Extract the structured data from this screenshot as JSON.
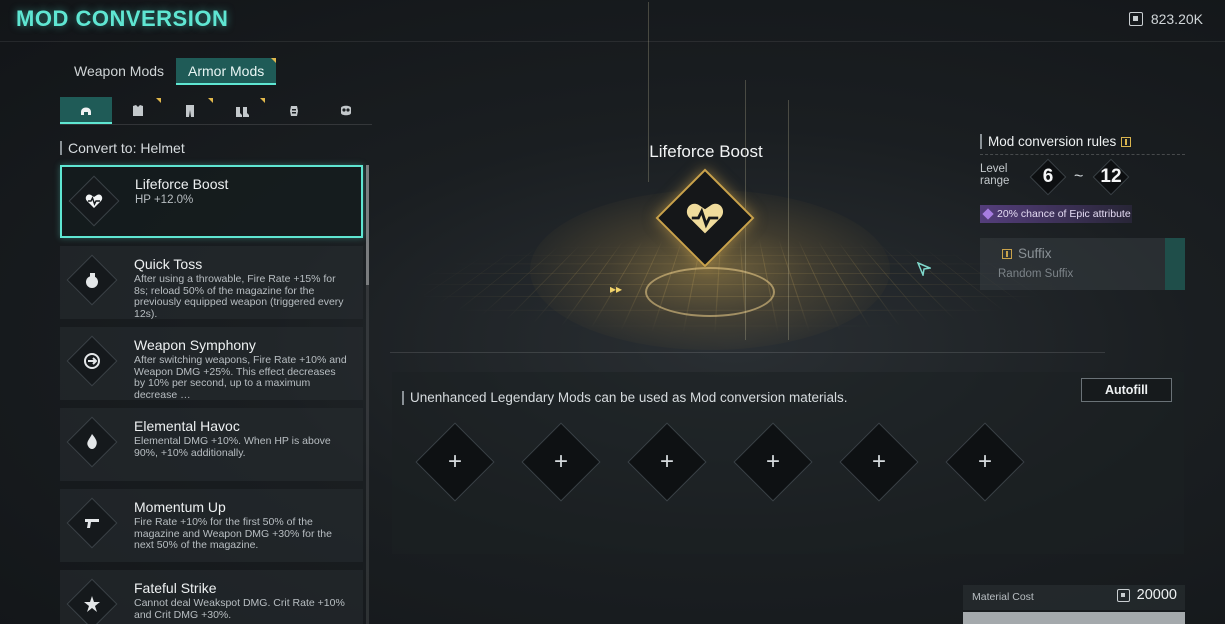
{
  "header": {
    "title": "MOD CONVERSION",
    "currency": "823.20K"
  },
  "tabs": [
    {
      "label": "Weapon Mods",
      "active": false
    },
    {
      "label": "Armor Mods",
      "active": true
    }
  ],
  "categories": [
    {
      "icon": "helmet-icon",
      "active": true
    },
    {
      "icon": "chest-armor-icon",
      "active": false
    },
    {
      "icon": "pants-icon",
      "active": false
    },
    {
      "icon": "boots-icon",
      "active": false
    },
    {
      "icon": "gloves-icon",
      "active": false
    },
    {
      "icon": "mask-icon",
      "active": false
    }
  ],
  "convert_to": "Convert to: Helmet",
  "mods": [
    {
      "name": "Lifeforce Boost",
      "desc": "HP +12.0%",
      "icon": "heart-icon",
      "selected": true
    },
    {
      "name": "Quick Toss",
      "desc": "After using a throwable, Fire Rate +15% for 8s; reload 50% of the magazine for the previously equipped weapon (triggered every 12s).",
      "icon": "grenade-icon",
      "selected": false
    },
    {
      "name": "Weapon Symphony",
      "desc": "After switching weapons, Fire Rate +10% and Weapon DMG +25%. This effect decreases by 10% per second, up to a maximum decrease …",
      "icon": "swap-icon",
      "selected": false
    },
    {
      "name": "Elemental Havoc",
      "desc": "Elemental DMG +10%. When HP is above 90%, +10% additionally.",
      "icon": "element-icon",
      "selected": false
    },
    {
      "name": "Momentum Up",
      "desc": "Fire Rate +10% for the first 50% of the magazine and Weapon DMG +30% for the next 50% of the magazine.",
      "icon": "gun-icon",
      "selected": false
    },
    {
      "name": "Fateful Strike",
      "desc": "Cannot deal Weakspot DMG. Crit Rate +10% and Crit DMG +30%.",
      "icon": "strike-icon",
      "selected": false
    }
  ],
  "preview": {
    "name": "Lifeforce Boost",
    "icon": "heart-icon"
  },
  "rules": {
    "title": "Mod conversion rules",
    "level_label": "Level range",
    "level_min": "6",
    "tilde": "~",
    "level_max": "12",
    "epic_chance": "20% chance of Epic attribute",
    "suffix_title": "Suffix",
    "suffix_sub": "Random Suffix"
  },
  "materials": {
    "label": "Unenhanced Legendary Mods can be used as Mod conversion materials.",
    "autofill": "Autofill",
    "slots": [
      "+",
      "+",
      "+",
      "+",
      "+",
      "+"
    ]
  },
  "cost": {
    "label": "Material Cost",
    "value": "20000"
  },
  "colors": {
    "accent": "#5fe6d2",
    "gold": "#c9a24b",
    "tab_active": "#1f5b57",
    "epic": "#a77de0"
  }
}
